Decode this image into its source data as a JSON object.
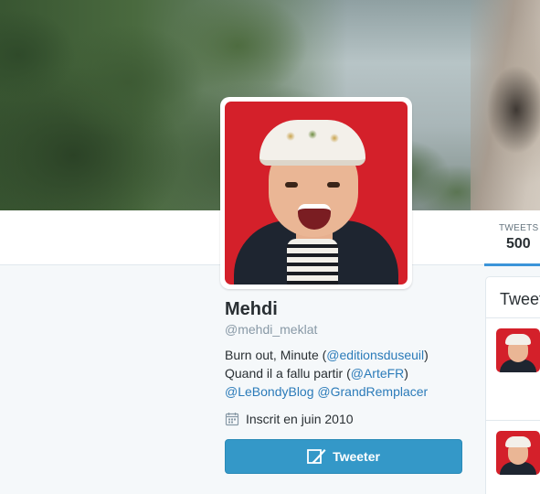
{
  "profile": {
    "name": "Mehdi",
    "handle": "@mehdi_meklat",
    "bio_line1_text": "Burn out, Minute (",
    "bio_line1_link": "@editionsduseuil",
    "bio_line1_end": ")",
    "bio_line2_text": "Quand il a fallu partir (",
    "bio_line2_link": "@ArteFR",
    "bio_line2_end": ")",
    "bio_line3_link1": "@LeBondyBlog",
    "bio_line3_link2": "@GrandRemplacer",
    "joined": "Inscrit en juin 2010",
    "joined_icon": "calendar-icon",
    "tweet_button_label": "Tweeter",
    "tweet_button_icon": "quill-icon"
  },
  "nav": {
    "stats": [
      {
        "label": "TWEETS",
        "value": "500"
      }
    ]
  },
  "timeline": {
    "title": "Tweets"
  },
  "colors": {
    "accent": "#3b94d9",
    "link": "#2b7bb9",
    "button": "#3498c8",
    "avatar_background": "#d4202a"
  }
}
